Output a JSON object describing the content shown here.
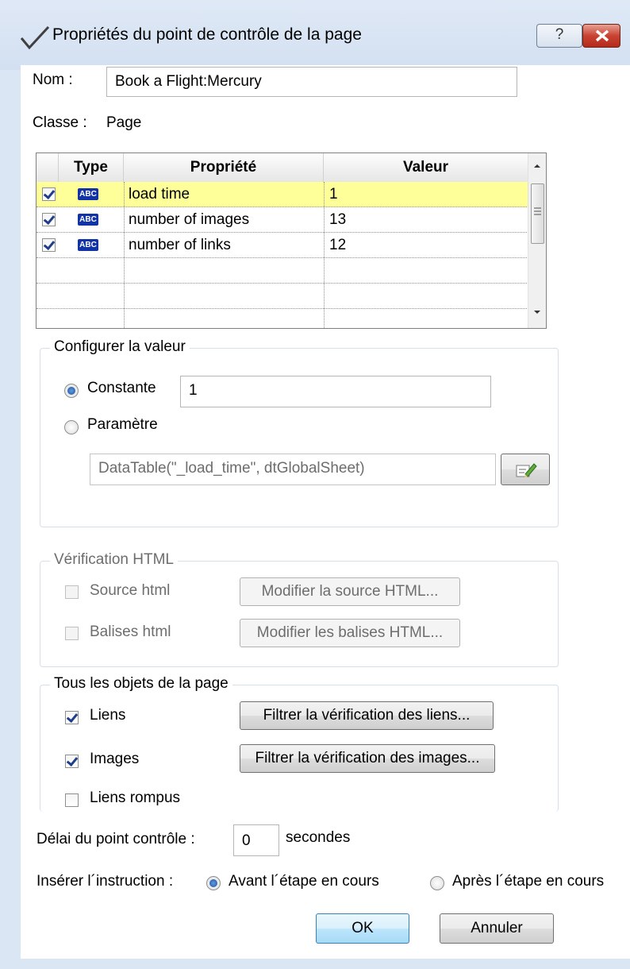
{
  "window": {
    "title": "Propriétés du point de contrôle de la page",
    "help_label": "?",
    "close_icon": "close-icon"
  },
  "name_label": "Nom :",
  "name_value": "Book a Flight:Mercury",
  "class_label": "Classe :",
  "class_value": "Page",
  "grid": {
    "headers": [
      "Type",
      "Propriété",
      "Valeur"
    ],
    "rows": [
      {
        "checked": true,
        "type_icon": "ABC",
        "property": "load time",
        "value": "1",
        "selected": true
      },
      {
        "checked": true,
        "type_icon": "ABC",
        "property": "number of images",
        "value": "13",
        "selected": false
      },
      {
        "checked": true,
        "type_icon": "ABC",
        "property": "number of links",
        "value": "12",
        "selected": false
      }
    ]
  },
  "configure": {
    "legend": "Configurer la valeur",
    "constant_label": "Constante",
    "constant_value": "1",
    "constant_selected": true,
    "parameter_label": "Paramètre",
    "parameter_value": "DataTable(\"_load_time\", dtGlobalSheet)"
  },
  "html_verification": {
    "legend": "Vérification HTML",
    "source_label": "Source html",
    "source_button": "Modifier la source HTML...",
    "tags_label": "Balises html",
    "tags_button": "Modifier les balises HTML..."
  },
  "all_objects": {
    "legend": "Tous les objets de la page",
    "links_label": "Liens",
    "links_checked": true,
    "links_button": "Filtrer la vérification des liens...",
    "images_label": "Images",
    "images_checked": true,
    "images_button": "Filtrer la vérification des images...",
    "broken_label": "Liens rompus",
    "broken_checked": false
  },
  "timeout_label": "Délai du point contrôle :",
  "timeout_value": "0",
  "timeout_unit": "secondes",
  "insert_label": "Insérer l´instruction :",
  "insert_before": "Avant l´étape en cours",
  "insert_after": "Après l´étape en cours",
  "insert_selected": "before",
  "ok_label": "OK",
  "cancel_label": "Annuler"
}
